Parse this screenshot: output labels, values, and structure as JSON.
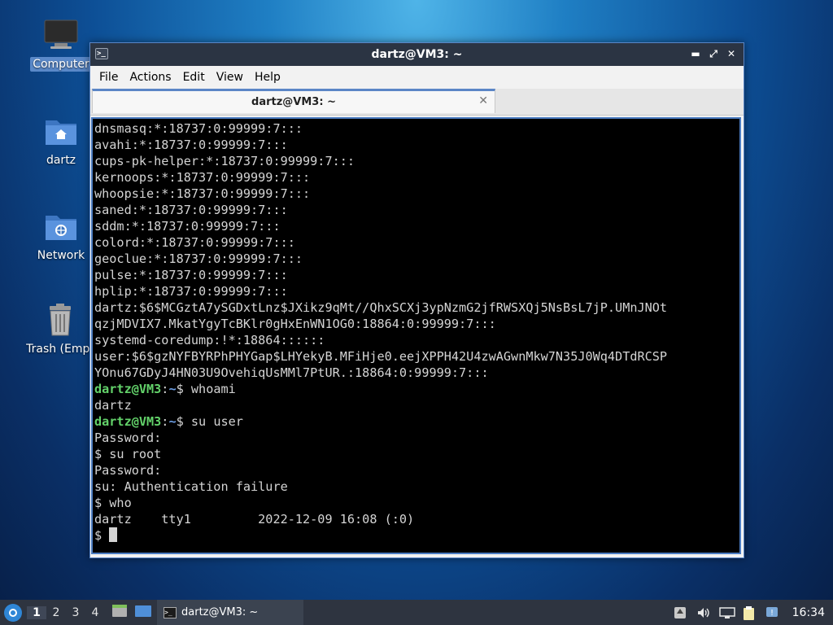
{
  "desktop": {
    "icons": [
      {
        "label": "Computer"
      },
      {
        "label": "dartz"
      },
      {
        "label": "Network"
      },
      {
        "label": "Trash (Empt"
      }
    ]
  },
  "window": {
    "title": "dartz@VM3: ~",
    "menu": [
      "File",
      "Actions",
      "Edit",
      "View",
      "Help"
    ],
    "tab_title": "dartz@VM3: ~",
    "terminal_lines": [
      "dnsmasq:*:18737:0:99999:7:::",
      "avahi:*:18737:0:99999:7:::",
      "cups-pk-helper:*:18737:0:99999:7:::",
      "kernoops:*:18737:0:99999:7:::",
      "whoopsie:*:18737:0:99999:7:::",
      "saned:*:18737:0:99999:7:::",
      "sddm:*:18737:0:99999:7:::",
      "colord:*:18737:0:99999:7:::",
      "geoclue:*:18737:0:99999:7:::",
      "pulse:*:18737:0:99999:7:::",
      "hplip:*:18737:0:99999:7:::",
      "dartz:$6$MCGztA7ySGDxtLnz$JXikz9qMt//QhxSCXj3ypNzmG2jfRWSXQj5NsBsL7jP.UMnJNOt",
      "qzjMDVIX7.MkatYgyTcBKlr0gHxEnWN1OG0:18864:0:99999:7:::",
      "systemd-coredump:!*:18864::::::",
      "user:$6$gzNYFBYRPhPHYGap$LHYekyB.MFiHje0.eejXPPH42U4zwAGwnMkw7N35J0Wq4DTdRCSP",
      "YOnu67GDyJ4HN03U9OvehiqUsMMl7PtUR.:18864:0:99999:7:::"
    ],
    "prompt": {
      "user": "dartz@VM3",
      "sep": ":",
      "path": "~",
      "symbol": "$ "
    },
    "cmd1": "whoami",
    "out1": "dartz",
    "cmd2": "su user",
    "tail_lines": [
      "Password:",
      "$ su root",
      "Password:",
      "su: Authentication failure",
      "$ who",
      "dartz    tty1         2022-12-09 16:08 (:0)"
    ],
    "last_prompt": "$ "
  },
  "taskbar": {
    "workspaces": [
      "1",
      "2",
      "3",
      "4"
    ],
    "active_workspace": "1",
    "app_label": "dartz@VM3: ~",
    "clock": "16:34"
  }
}
